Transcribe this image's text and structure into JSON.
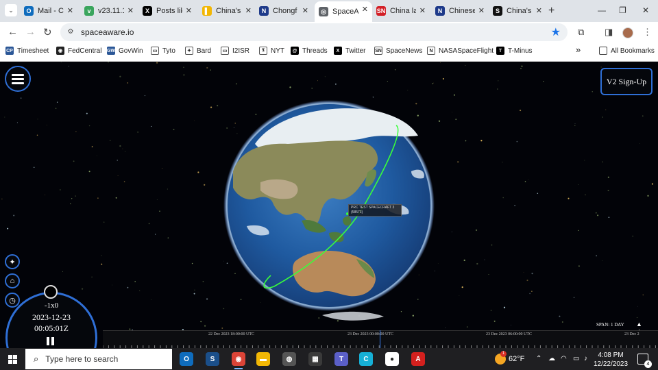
{
  "browser": {
    "tabs": [
      {
        "label": "Mail - C",
        "icon": "outlook-icon",
        "color": "#0f6cbd",
        "glyph": "O"
      },
      {
        "label": "v23.11.1",
        "icon": "leaf-icon",
        "color": "#3aa55d",
        "glyph": "v"
      },
      {
        "label": "Posts lik",
        "icon": "x-icon",
        "color": "#000000",
        "glyph": "X"
      },
      {
        "label": "China's",
        "icon": "news-icon",
        "color": "#f2b705",
        "glyph": "▌"
      },
      {
        "label": "Chongf",
        "icon": "nasaspaceflight-icon",
        "color": "#1e3a8a",
        "glyph": "N"
      },
      {
        "label": "SpaceAw",
        "icon": "globe-icon",
        "color": "#5f6368",
        "glyph": "◎"
      },
      {
        "label": "China la",
        "icon": "spacenews-icon",
        "color": "#d31f26",
        "glyph": "SN"
      },
      {
        "label": "Chinese",
        "icon": "nasaspaceflight-icon",
        "color": "#1e3a8a",
        "glyph": "N"
      },
      {
        "label": "China's",
        "icon": "s-icon",
        "color": "#111111",
        "glyph": "S"
      }
    ],
    "active_tab_index": 5,
    "new_tab": "+",
    "url": "spaceaware.io",
    "bookmarks": [
      {
        "label": "Timesheet",
        "icon": "cp-icon",
        "color": "#2b5797",
        "glyph": "CP"
      },
      {
        "label": "FedCentral",
        "icon": "fedcentral-icon",
        "color": "#222222",
        "glyph": "◉"
      },
      {
        "label": "GovWin",
        "icon": "govwin-icon",
        "color": "#2b5797",
        "glyph": "GW"
      },
      {
        "label": "Tyto",
        "icon": "folder-icon",
        "color": "#ffffff",
        "glyph": "▭"
      },
      {
        "label": "Bard",
        "icon": "bard-icon",
        "color": "#ffffff",
        "glyph": "✦"
      },
      {
        "label": "I2ISR",
        "icon": "folder-icon",
        "color": "#ffffff",
        "glyph": "▭"
      },
      {
        "label": "NYT",
        "icon": "nyt-icon",
        "color": "#ffffff",
        "glyph": "𝕿"
      },
      {
        "label": "Threads",
        "icon": "threads-icon",
        "color": "#000000",
        "glyph": "@"
      },
      {
        "label": "Twitter",
        "icon": "x-icon",
        "color": "#000000",
        "glyph": "X"
      },
      {
        "label": "SpaceNews",
        "icon": "spacenews-icon",
        "color": "#ffffff",
        "glyph": "SN"
      },
      {
        "label": "NASASpaceFlight",
        "icon": "nasaspaceflight-icon",
        "color": "#ffffff",
        "glyph": "N"
      },
      {
        "label": "T-Minus",
        "icon": "tminus-icon",
        "color": "#000000",
        "glyph": "T"
      }
    ],
    "bookmarks_overflow": "»",
    "all_bookmarks": "All Bookmarks"
  },
  "app": {
    "signup_label": "V2 Sign-Up",
    "satellite_label_line1": "PRC TEST SPACECRAFT 3",
    "satellite_label_line2": "(58573)",
    "clock": {
      "rate": "-1x0",
      "date": "2023-12-23",
      "time": "00:05:01Z"
    },
    "span_label": "SPAN: 1 DAY",
    "span_arrows": "▲ ▲",
    "timeline_ticks": [
      "22 Dec 2023 18:00:00 UTC",
      "23 Dec 2023 00:00:00 UTC",
      "23 Dec 2023 06:00:00 UTC",
      "23 Dec 2"
    ],
    "orbit_color": "#39ff3a",
    "accent_color": "#2f6fd6"
  },
  "taskbar": {
    "search_placeholder": "Type here to search",
    "apps": [
      {
        "name": "outlook-icon",
        "color": "#0f6cbd",
        "glyph": "O"
      },
      {
        "name": "s-app-icon",
        "color": "#1b4f8a",
        "glyph": "S"
      },
      {
        "name": "chrome-icon",
        "color": "#db4437",
        "glyph": "◉"
      },
      {
        "name": "file-explorer-icon",
        "color": "#f2b705",
        "glyph": "▬"
      },
      {
        "name": "satellite-app-icon",
        "color": "#555555",
        "glyph": "◍"
      },
      {
        "name": "calculator-icon",
        "color": "#3a3a3a",
        "glyph": "▦"
      },
      {
        "name": "teams-icon",
        "color": "#5b5fc7",
        "glyph": "T"
      },
      {
        "name": "canva-icon",
        "color": "#16b0d6",
        "glyph": "C"
      },
      {
        "name": "app-icon",
        "color": "#ffffff",
        "glyph": "●"
      },
      {
        "name": "acrobat-icon",
        "color": "#d3201e",
        "glyph": "A"
      }
    ],
    "weather_temp": "62°F",
    "weather_badge": "1",
    "time": "4:08 PM",
    "date": "12/22/2023",
    "notifications": "4"
  }
}
